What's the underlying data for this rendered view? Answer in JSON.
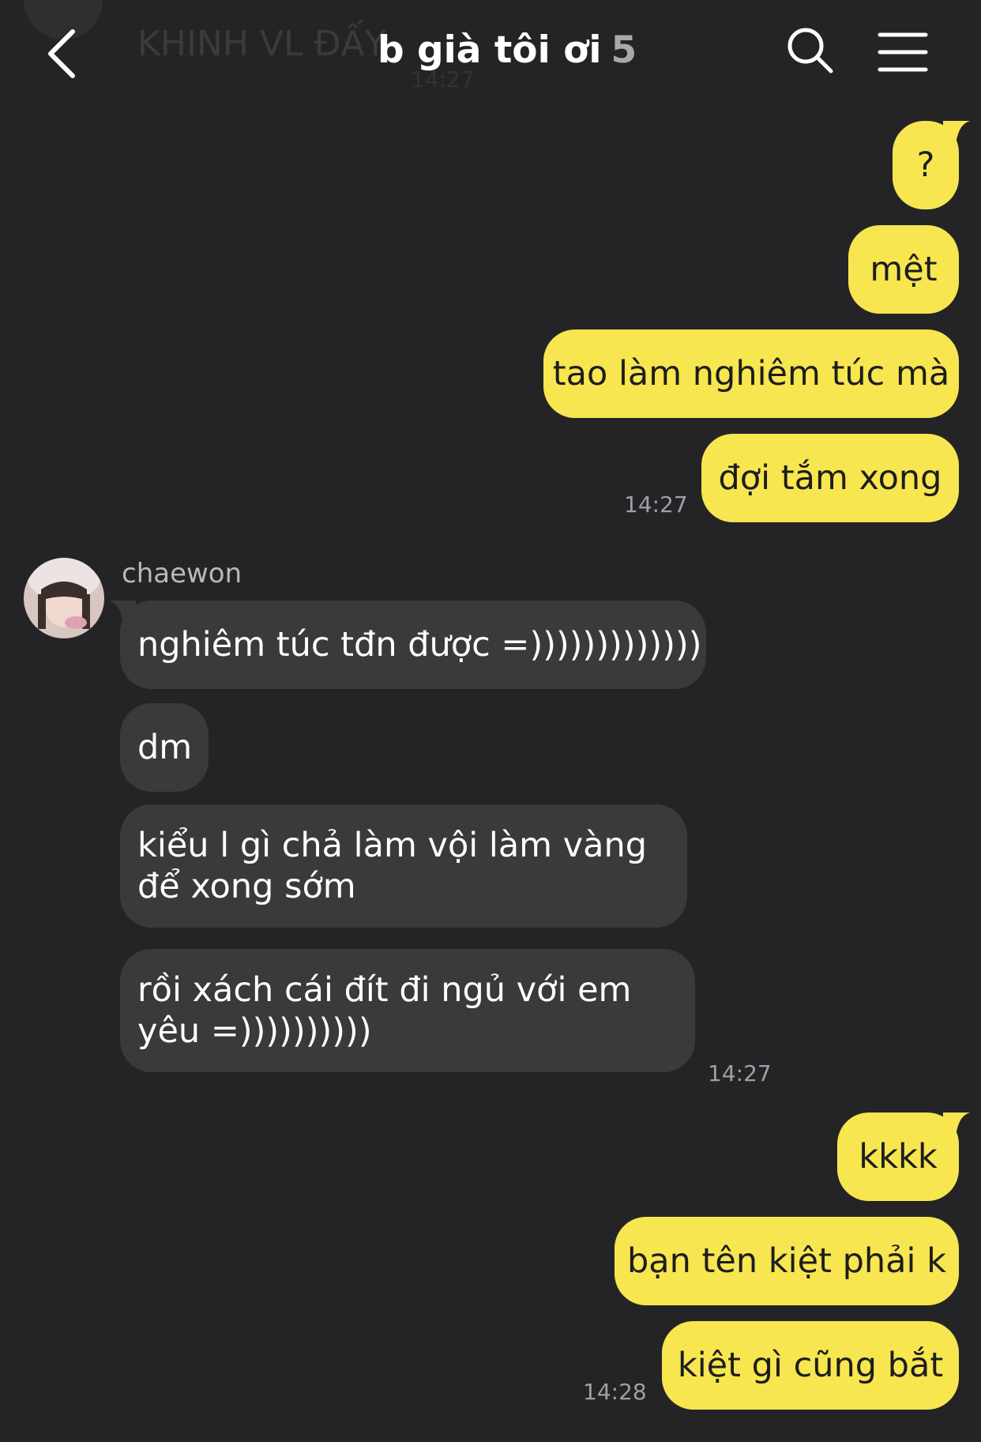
{
  "header": {
    "title": "b già tôi ơi",
    "member_count": "5",
    "ghost_text": "KHINH VL ĐẤY",
    "ghost_time": "14:27"
  },
  "messages": {
    "out1": [
      "?",
      "mệt",
      "tao làm nghiêm túc mà",
      "đợi tắm xong"
    ],
    "out1_time": "14:27",
    "sender": "chaewon",
    "in1": [
      "nghiêm túc tđn được =)))))))))))))",
      "dm",
      "kiểu l gì chả làm vội làm vàng để xong sớm",
      "rồi xách cái đít đi ngủ với em yêu =))))))))))"
    ],
    "in1_time": "14:27",
    "out2": [
      "kkkk",
      "bạn tên kiệt phải k",
      "kiệt gì cũng bắt"
    ],
    "out2_time": "14:28"
  },
  "colors": {
    "background": "#242427",
    "outgoing_bubble": "#f7e64f",
    "incoming_bubble": "#3a3a3d"
  }
}
